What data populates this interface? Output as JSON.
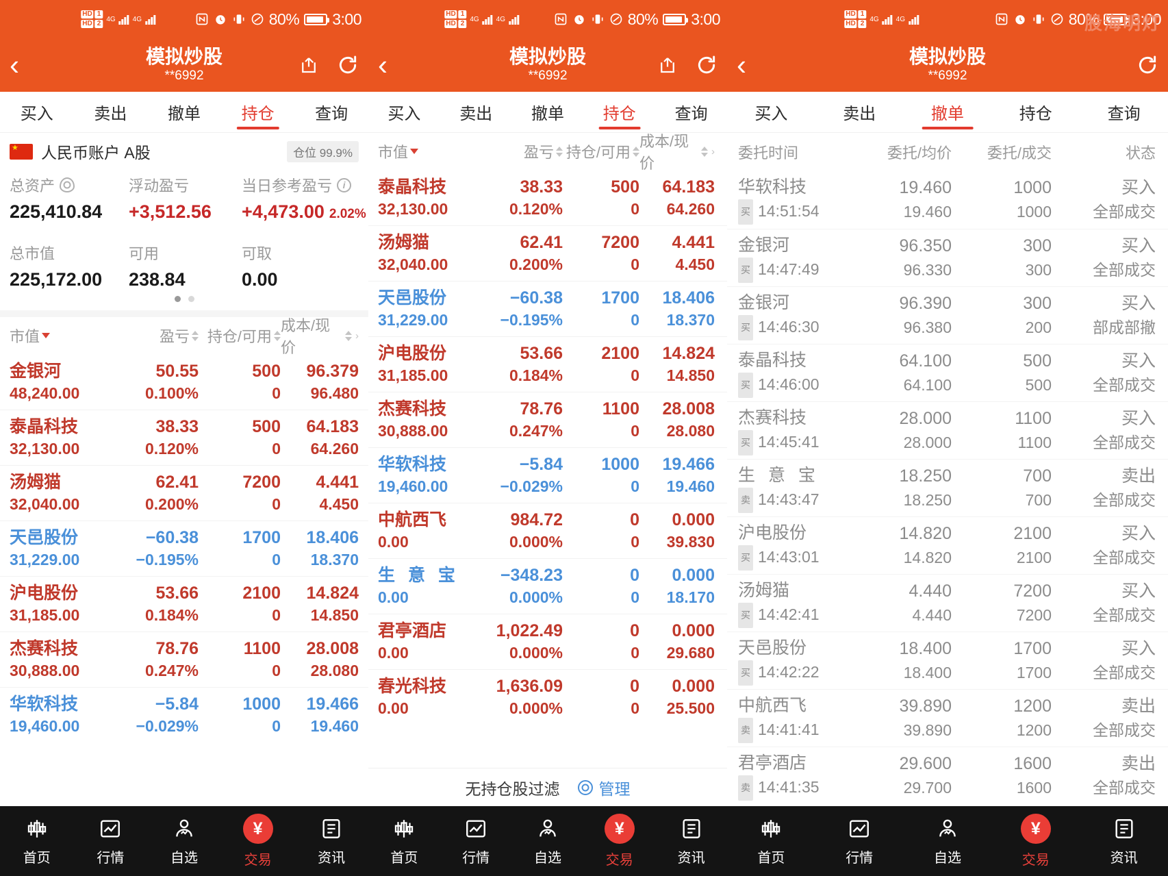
{
  "statusbar": {
    "hd1": "HD",
    "hd2": "HD",
    "sim1": "1",
    "sim2": "2",
    "net1": "4G",
    "net2": "4G",
    "battery_pct": "80%",
    "time": "3:00"
  },
  "titlebar": {
    "title": "模拟炒股",
    "account": "**6992",
    "back_icon": "chevron-left-icon",
    "share_icon": "share-icon",
    "refresh_icon": "refresh-icon"
  },
  "watermark": "股海明灯",
  "tabs": [
    "买入",
    "卖出",
    "撤单",
    "持仓",
    "查询"
  ],
  "panel1": {
    "active_tab": "持仓",
    "account_label": "人民币账户 A股",
    "position_badge": "仓位 99.9%",
    "summary": [
      {
        "label": "总资产",
        "value": "225,410.84",
        "icon": "eye-icon",
        "color": "black",
        "pct": ""
      },
      {
        "label": "浮动盈亏",
        "value": "+3,512.56",
        "icon": "",
        "color": "red",
        "pct": ""
      },
      {
        "label": "当日参考盈亏",
        "value": "+4,473.00",
        "icon": "info-icon",
        "color": "red",
        "pct": "2.02%"
      },
      {
        "label": "总市值",
        "value": "225,172.00",
        "icon": "",
        "color": "black",
        "pct": ""
      },
      {
        "label": "可用",
        "value": "238.84",
        "icon": "",
        "color": "black",
        "pct": ""
      },
      {
        "label": "可取",
        "value": "0.00",
        "icon": "",
        "color": "black",
        "pct": ""
      }
    ],
    "columns": [
      "市值",
      "盈亏",
      "持仓/可用",
      "成本/现价"
    ],
    "rows": [
      {
        "name": "金银河",
        "value": "48,240.00",
        "pl": "50.55",
        "plpct": "0.100%",
        "qty": "500",
        "avail": "0",
        "cost": "96.379",
        "price": "96.480",
        "color": "red"
      },
      {
        "name": "泰晶科技",
        "value": "32,130.00",
        "pl": "38.33",
        "plpct": "0.120%",
        "qty": "500",
        "avail": "0",
        "cost": "64.183",
        "price": "64.260",
        "color": "red"
      },
      {
        "name": "汤姆猫",
        "value": "32,040.00",
        "pl": "62.41",
        "plpct": "0.200%",
        "qty": "7200",
        "avail": "0",
        "cost": "4.441",
        "price": "4.450",
        "color": "red"
      },
      {
        "name": "天邑股份",
        "value": "31,229.00",
        "pl": "−60.38",
        "plpct": "−0.195%",
        "qty": "1700",
        "avail": "0",
        "cost": "18.406",
        "price": "18.370",
        "color": "blue"
      },
      {
        "name": "沪电股份",
        "value": "31,185.00",
        "pl": "53.66",
        "plpct": "0.184%",
        "qty": "2100",
        "avail": "0",
        "cost": "14.824",
        "price": "14.850",
        "color": "red"
      },
      {
        "name": "杰赛科技",
        "value": "30,888.00",
        "pl": "78.76",
        "plpct": "0.247%",
        "qty": "1100",
        "avail": "0",
        "cost": "28.008",
        "price": "28.080",
        "color": "red"
      },
      {
        "name": "华软科技",
        "value": "19,460.00",
        "pl": "−5.84",
        "plpct": "−0.029%",
        "qty": "1000",
        "avail": "0",
        "cost": "19.466",
        "price": "19.460",
        "color": "blue"
      }
    ]
  },
  "panel2": {
    "active_tab": "持仓",
    "columns": [
      "市值",
      "盈亏",
      "持仓/可用",
      "成本/现价"
    ],
    "rows": [
      {
        "name": "泰晶科技",
        "value": "32,130.00",
        "pl": "38.33",
        "plpct": "0.120%",
        "qty": "500",
        "avail": "0",
        "cost": "64.183",
        "price": "64.260",
        "color": "red"
      },
      {
        "name": "汤姆猫",
        "value": "32,040.00",
        "pl": "62.41",
        "plpct": "0.200%",
        "qty": "7200",
        "avail": "0",
        "cost": "4.441",
        "price": "4.450",
        "color": "red"
      },
      {
        "name": "天邑股份",
        "value": "31,229.00",
        "pl": "−60.38",
        "plpct": "−0.195%",
        "qty": "1700",
        "avail": "0",
        "cost": "18.406",
        "price": "18.370",
        "color": "blue"
      },
      {
        "name": "沪电股份",
        "value": "31,185.00",
        "pl": "53.66",
        "plpct": "0.184%",
        "qty": "2100",
        "avail": "0",
        "cost": "14.824",
        "price": "14.850",
        "color": "red"
      },
      {
        "name": "杰赛科技",
        "value": "30,888.00",
        "pl": "78.76",
        "plpct": "0.247%",
        "qty": "1100",
        "avail": "0",
        "cost": "28.008",
        "price": "28.080",
        "color": "red"
      },
      {
        "name": "华软科技",
        "value": "19,460.00",
        "pl": "−5.84",
        "plpct": "−0.029%",
        "qty": "1000",
        "avail": "0",
        "cost": "19.466",
        "price": "19.460",
        "color": "blue"
      },
      {
        "name": "中航西飞",
        "value": "0.00",
        "pl": "984.72",
        "plpct": "0.000%",
        "qty": "0",
        "avail": "0",
        "cost": "0.000",
        "price": "39.830",
        "color": "red"
      },
      {
        "name": "生 意 宝",
        "value": "0.00",
        "pl": "−348.23",
        "plpct": "0.000%",
        "qty": "0",
        "avail": "0",
        "cost": "0.000",
        "price": "18.170",
        "color": "blue"
      },
      {
        "name": "君亭酒店",
        "value": "0.00",
        "pl": "1,022.49",
        "plpct": "0.000%",
        "qty": "0",
        "avail": "0",
        "cost": "0.000",
        "price": "29.680",
        "color": "red"
      },
      {
        "name": "春光科技",
        "value": "0.00",
        "pl": "1,636.09",
        "plpct": "0.000%",
        "qty": "0",
        "avail": "0",
        "cost": "0.000",
        "price": "25.500",
        "color": "red"
      }
    ],
    "filter_label": "无持仓股过滤",
    "manage_label": "管理",
    "manage_icon": "gear-icon"
  },
  "panel3": {
    "active_tab": "撤单",
    "columns": [
      "委托时间",
      "委托/均价",
      "委托/成交",
      "状态"
    ],
    "rows": [
      {
        "name": "华软科技",
        "side": "买",
        "time": "14:51:54",
        "order_price": "19.460",
        "avg_price": "19.460",
        "order_qty": "1000",
        "filled_qty": "1000",
        "side_text": "买入",
        "status": "全部成交"
      },
      {
        "name": "金银河",
        "side": "买",
        "time": "14:47:49",
        "order_price": "96.350",
        "avg_price": "96.330",
        "order_qty": "300",
        "filled_qty": "300",
        "side_text": "买入",
        "status": "全部成交"
      },
      {
        "name": "金银河",
        "side": "买",
        "time": "14:46:30",
        "order_price": "96.390",
        "avg_price": "96.380",
        "order_qty": "300",
        "filled_qty": "200",
        "side_text": "买入",
        "status": "部成部撤"
      },
      {
        "name": "泰晶科技",
        "side": "买",
        "time": "14:46:00",
        "order_price": "64.100",
        "avg_price": "64.100",
        "order_qty": "500",
        "filled_qty": "500",
        "side_text": "买入",
        "status": "全部成交"
      },
      {
        "name": "杰赛科技",
        "side": "买",
        "time": "14:45:41",
        "order_price": "28.000",
        "avg_price": "28.000",
        "order_qty": "1100",
        "filled_qty": "1100",
        "side_text": "买入",
        "status": "全部成交"
      },
      {
        "name": "生 意 宝",
        "side": "卖",
        "time": "14:43:47",
        "order_price": "18.250",
        "avg_price": "18.250",
        "order_qty": "700",
        "filled_qty": "700",
        "side_text": "卖出",
        "status": "全部成交"
      },
      {
        "name": "沪电股份",
        "side": "买",
        "time": "14:43:01",
        "order_price": "14.820",
        "avg_price": "14.820",
        "order_qty": "2100",
        "filled_qty": "2100",
        "side_text": "买入",
        "status": "全部成交"
      },
      {
        "name": "汤姆猫",
        "side": "买",
        "time": "14:42:41",
        "order_price": "4.440",
        "avg_price": "4.440",
        "order_qty": "7200",
        "filled_qty": "7200",
        "side_text": "买入",
        "status": "全部成交"
      },
      {
        "name": "天邑股份",
        "side": "买",
        "time": "14:42:22",
        "order_price": "18.400",
        "avg_price": "18.400",
        "order_qty": "1700",
        "filled_qty": "1700",
        "side_text": "买入",
        "status": "全部成交"
      },
      {
        "name": "中航西飞",
        "side": "卖",
        "time": "14:41:41",
        "order_price": "39.890",
        "avg_price": "39.890",
        "order_qty": "1200",
        "filled_qty": "1200",
        "side_text": "卖出",
        "status": "全部成交"
      },
      {
        "name": "君亭酒店",
        "side": "卖",
        "time": "14:41:35",
        "order_price": "29.600",
        "avg_price": "29.700",
        "order_qty": "1600",
        "filled_qty": "1600",
        "side_text": "卖出",
        "status": "全部成交"
      }
    ]
  },
  "bottomnav": {
    "items": [
      {
        "label": "首页",
        "icon": "candlestick-icon",
        "active": false
      },
      {
        "label": "行情",
        "icon": "chart-line-icon",
        "active": false
      },
      {
        "label": "自选",
        "icon": "person-icon",
        "active": false
      },
      {
        "label": "交易",
        "icon": "yuan-icon",
        "active": true
      },
      {
        "label": "资讯",
        "icon": "news-icon",
        "active": false
      }
    ],
    "trade_symbol": "¥"
  }
}
